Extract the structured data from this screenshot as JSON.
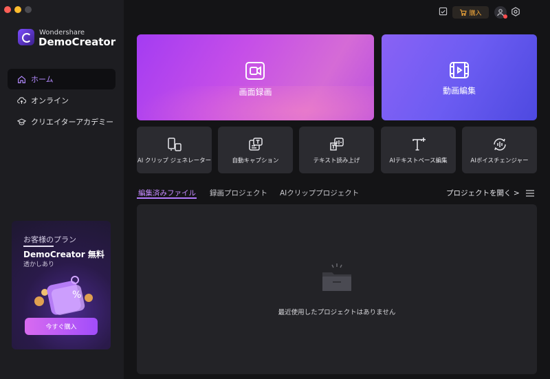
{
  "brand": {
    "name_small": "Wondershare",
    "name_big": "DemoCreator"
  },
  "sidebar": {
    "items": [
      {
        "label": "ホーム",
        "active": true,
        "icon": "home-icon"
      },
      {
        "label": "オンライン",
        "active": false,
        "icon": "cloud-upload-icon"
      },
      {
        "label": "クリエイターアカデミー",
        "active": false,
        "icon": "graduation-cap-icon"
      }
    ]
  },
  "promo": {
    "heading": "お客様のプラン",
    "plan": "DemoCreator 無料",
    "note": "透かしあり",
    "button": "今すぐ購入"
  },
  "topbar": {
    "buy_label": "購入"
  },
  "cards": {
    "record_label": "画面録画",
    "edit_label": "動画編集"
  },
  "tools": [
    {
      "label": "AI クリップ ジェネレーター",
      "icon": "ai-clip-icon"
    },
    {
      "label": "自動キャプション",
      "icon": "caption-icon"
    },
    {
      "label": "テキスト読み上げ",
      "icon": "tts-icon"
    },
    {
      "label": "AIテキストベース編集",
      "icon": "text-edit-icon"
    },
    {
      "label": "AIボイスチェンジャー",
      "icon": "voice-changer-icon"
    }
  ],
  "tabs": [
    {
      "label": "編集済みファイル",
      "active": true
    },
    {
      "label": "録画プロジェクト",
      "active": false
    },
    {
      "label": "AIクリッププロジェクト",
      "active": false
    }
  ],
  "open_project": "プロジェクトを開く >",
  "empty_message": "最近使用したプロジェクトはありません",
  "colors": {
    "accent": "#b67cff",
    "buy_orange": "#f0a63a",
    "background": "#141416",
    "sidebar": "#1d1d21"
  }
}
